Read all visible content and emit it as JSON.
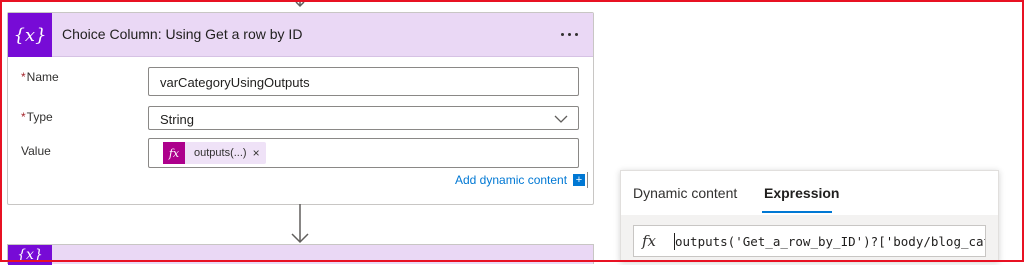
{
  "card": {
    "title": "Choice Column: Using Get a row by ID",
    "icon": "variable-icon",
    "icon_symbol": "{x}",
    "header_color": "#ead8f5",
    "icon_color": "#770bd6",
    "fields": {
      "name": {
        "label": "Name",
        "required_mark": "*",
        "value": "varCategoryUsingOutputs"
      },
      "type": {
        "label": "Type",
        "required_mark": "*",
        "value": "String"
      },
      "value": {
        "label": "Value",
        "token_icon": "fx",
        "token_text": "outputs(...)",
        "token_close": "×"
      }
    },
    "add_dynamic_content": "Add dynamic content",
    "add_dynamic_icon": "+"
  },
  "next_card": {
    "icon_symbol": "{x}"
  },
  "panel": {
    "tabs": [
      "Dynamic content",
      "Expression"
    ],
    "active_tab": "Expression",
    "fx_label": "fx",
    "expression": "outputs('Get_a_row_by_ID')?['body/blog_category']"
  },
  "colors": {
    "accent": "#0078d4",
    "token_icon": "#ad008c",
    "frame": "#e81123"
  }
}
